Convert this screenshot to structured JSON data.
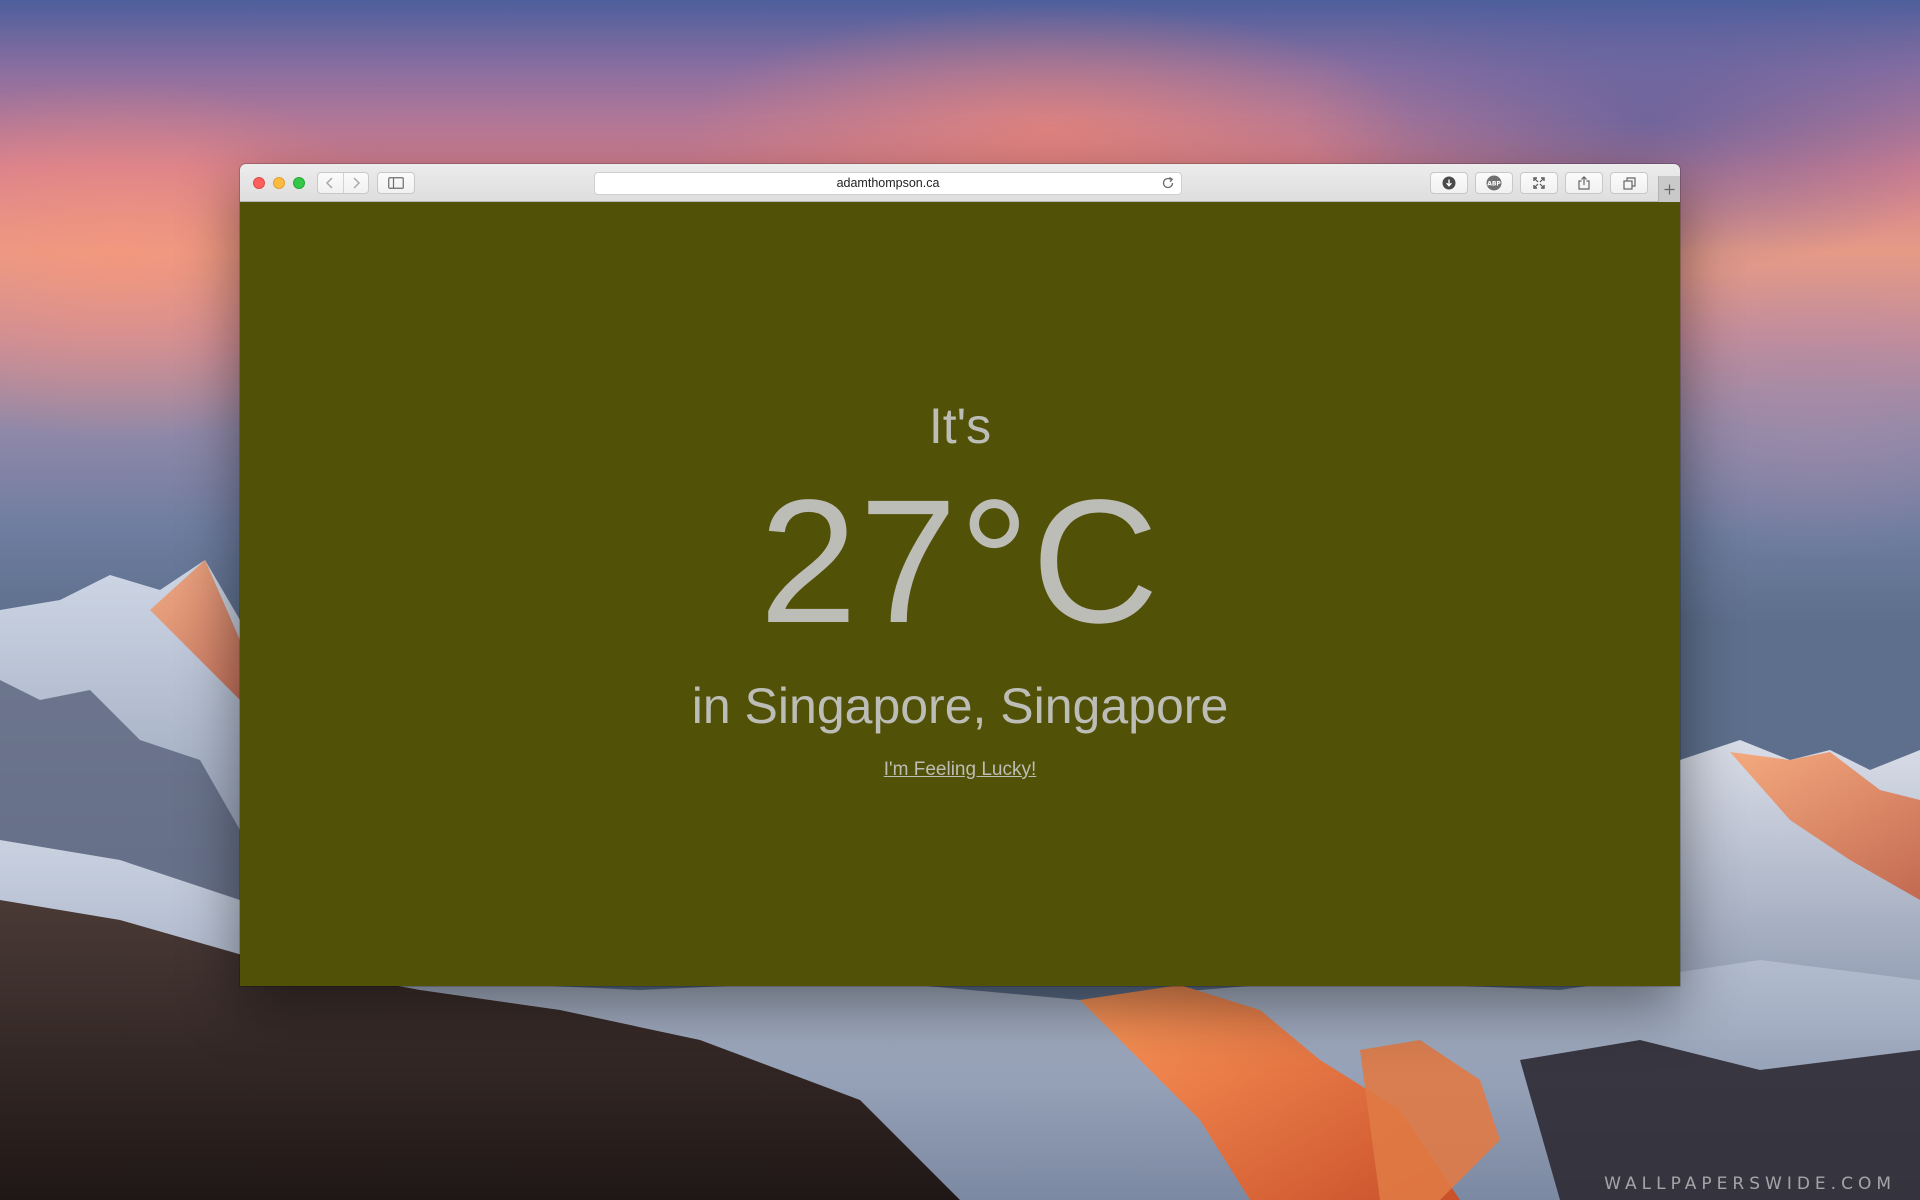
{
  "browser": {
    "address": "adamthompson.ca",
    "toolbar_icons": [
      "downloads-icon",
      "adblock-icon",
      "fullscreen-icon",
      "share-icon",
      "tabs-overview-icon"
    ]
  },
  "page": {
    "background_color": "#515107",
    "text_color": "#bdbdb7",
    "intro": "It's",
    "temperature": "27°C",
    "location": "in Singapore, Singapore",
    "lucky_link": "I'm Feeling Lucky!"
  },
  "desktop": {
    "watermark": "WALLPAPERSWIDE.COM"
  }
}
